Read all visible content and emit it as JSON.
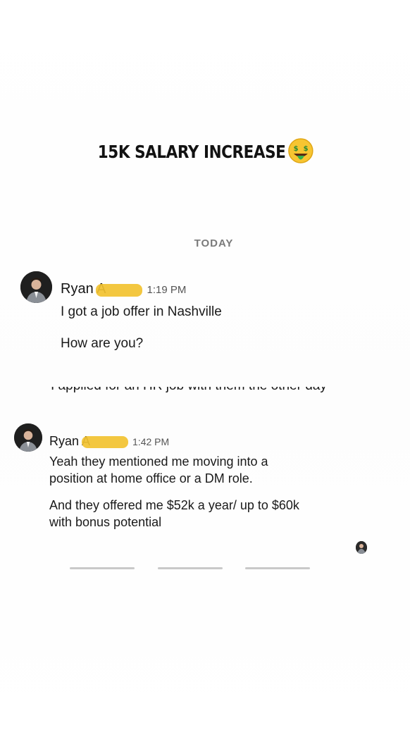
{
  "headline": {
    "text": "15K SALARY INCREASE",
    "emoji": "money-mouth-face"
  },
  "divider": {
    "label": "TODAY"
  },
  "messages": [
    {
      "sender": "Ryan A",
      "time": "1:19 PM",
      "lines": [
        "I got a job offer in Nashville",
        "How are you?"
      ]
    },
    {
      "partial_line": "I applied for an HR job with them the other day"
    },
    {
      "sender": "Ryan A",
      "time": "1:42 PM",
      "lines": [
        "Yeah they mentioned me moving  into a",
        "position at home office or a DM role.",
        "And they offered me $52k a year/ up to $60k",
        "with bonus potential"
      ]
    }
  ],
  "colors": {
    "redaction": "#f2c230",
    "divider_text": "#7a7a7a",
    "time_text": "#555555"
  }
}
